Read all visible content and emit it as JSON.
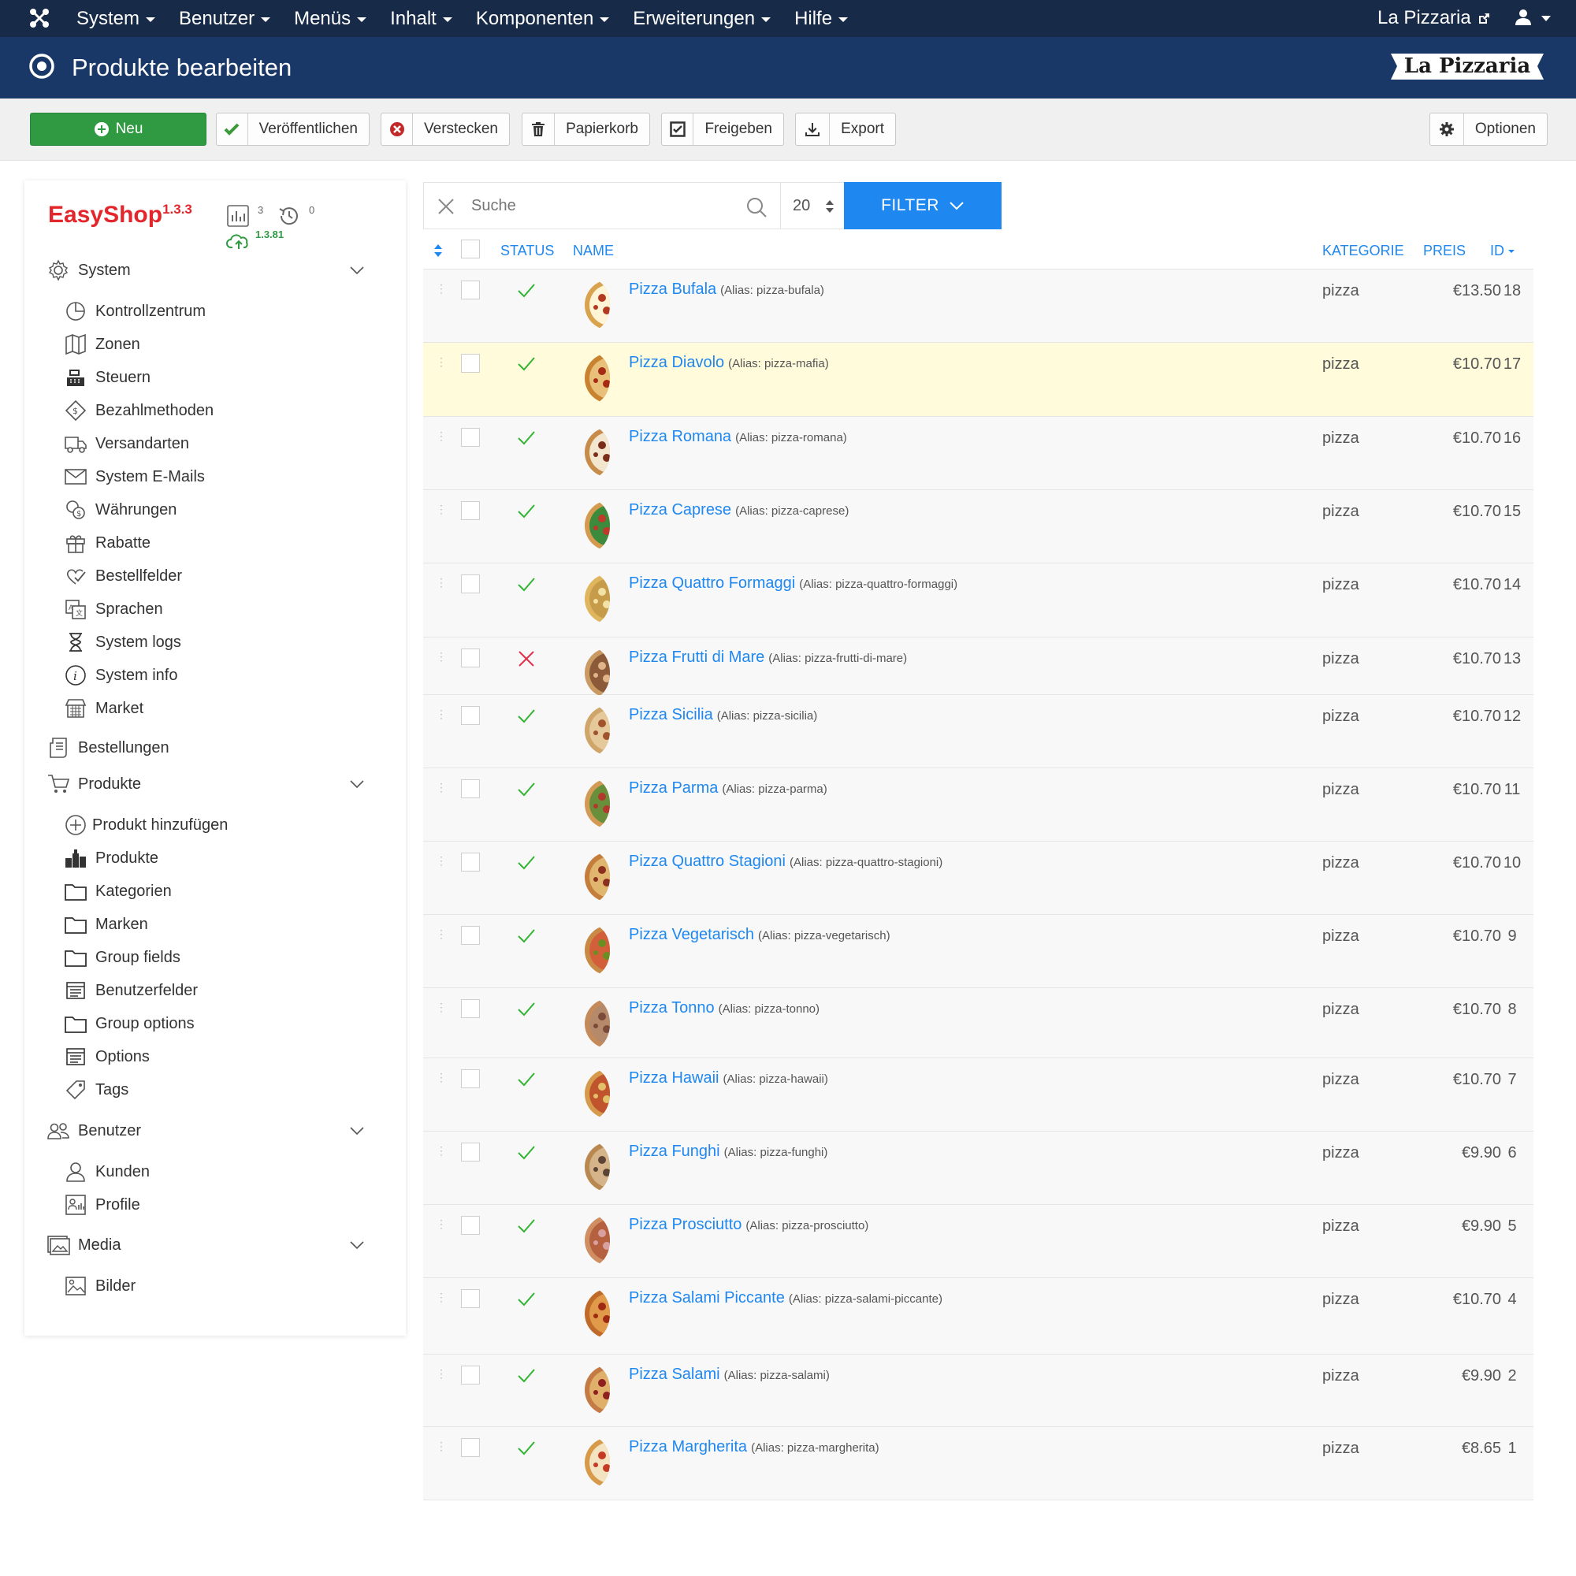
{
  "topbar": {
    "menu": [
      "System",
      "Benutzer",
      "Menüs",
      "Inhalt",
      "Komponenten",
      "Erweiterungen",
      "Hilfe"
    ],
    "site_link": "La Pizzaria"
  },
  "titlebar": {
    "title": "Produkte bearbeiten",
    "brand": "La Pizzaria"
  },
  "toolbar": {
    "new_label": "Neu",
    "publish_label": "Veröffentlichen",
    "hide_label": "Verstecken",
    "trash_label": "Papierkorb",
    "release_label": "Freigeben",
    "export_label": "Export",
    "options_label": "Optionen"
  },
  "sidebar": {
    "logo": "EasyShop",
    "logo_version": "1.3.3",
    "stat_count": "3",
    "stat_history": "0",
    "update_version": "1.3.81",
    "system": {
      "label": "System",
      "items": [
        "Kontrollzentrum",
        "Zonen",
        "Steuern",
        "Bezahlmethoden",
        "Versandarten",
        "System E-Mails",
        "Währungen",
        "Rabatte",
        "Bestellfelder",
        "Sprachen",
        "System logs",
        "System info",
        "Market"
      ]
    },
    "orders": {
      "label": "Bestellungen"
    },
    "products": {
      "label": "Produkte",
      "items": [
        "Produkt hinzufügen",
        "Produkte",
        "Kategorien",
        "Marken",
        "Group fields",
        "Benutzerfelder",
        "Group options",
        "Options",
        "Tags"
      ]
    },
    "users": {
      "label": "Benutzer",
      "items": [
        "Kunden",
        "Profile"
      ]
    },
    "media": {
      "label": "Media",
      "items": [
        "Bilder"
      ]
    }
  },
  "search": {
    "placeholder": "Suche",
    "limit": "20",
    "filter_label": "FILTER"
  },
  "table": {
    "headers": {
      "status": "STATUS",
      "name": "NAME",
      "category": "KATEGORIE",
      "price": "PREIS",
      "id": "ID"
    },
    "alias_prefix": "Alias:",
    "rows": [
      {
        "name": "Pizza Bufala",
        "alias": "pizza-bufala",
        "category": "pizza",
        "price": "€13.50",
        "id": "18",
        "published": true
      },
      {
        "name": "Pizza Diavolo",
        "alias": "pizza-mafia",
        "category": "pizza",
        "price": "€10.70",
        "id": "17",
        "published": true
      },
      {
        "name": "Pizza Romana",
        "alias": "pizza-romana",
        "category": "pizza",
        "price": "€10.70",
        "id": "16",
        "published": true
      },
      {
        "name": "Pizza Caprese",
        "alias": "pizza-caprese",
        "category": "pizza",
        "price": "€10.70",
        "id": "15",
        "published": true
      },
      {
        "name": "Pizza Quattro Formaggi",
        "alias": "pizza-quattro-formaggi",
        "category": "pizza",
        "price": "€10.70",
        "id": "14",
        "published": true
      },
      {
        "name": "Pizza Frutti di Mare",
        "alias": "pizza-frutti-di-mare",
        "category": "pizza",
        "price": "€10.70",
        "id": "13",
        "published": false
      },
      {
        "name": "Pizza Sicilia",
        "alias": "pizza-sicilia",
        "category": "pizza",
        "price": "€10.70",
        "id": "12",
        "published": true
      },
      {
        "name": "Pizza Parma",
        "alias": "pizza-parma",
        "category": "pizza",
        "price": "€10.70",
        "id": "11",
        "published": true
      },
      {
        "name": "Pizza Quattro Stagioni",
        "alias": "pizza-quattro-stagioni",
        "category": "pizza",
        "price": "€10.70",
        "id": "10",
        "published": true
      },
      {
        "name": "Pizza Vegetarisch",
        "alias": "pizza-vegetarisch",
        "category": "pizza",
        "price": "€10.70",
        "id": "9",
        "published": true
      },
      {
        "name": "Pizza Tonno",
        "alias": "pizza-tonno",
        "category": "pizza",
        "price": "€10.70",
        "id": "8",
        "published": true
      },
      {
        "name": "Pizza Hawaii",
        "alias": "pizza-hawaii",
        "category": "pizza",
        "price": "€10.70",
        "id": "7",
        "published": true
      },
      {
        "name": "Pizza Funghi",
        "alias": "pizza-funghi",
        "category": "pizza",
        "price": "€9.90",
        "id": "6",
        "published": true
      },
      {
        "name": "Pizza Prosciutto",
        "alias": "pizza-prosciutto",
        "category": "pizza",
        "price": "€9.90",
        "id": "5",
        "published": true
      },
      {
        "name": "Pizza Salami Piccante",
        "alias": "pizza-salami-piccante",
        "category": "pizza",
        "price": "€10.70",
        "id": "4",
        "published": true
      },
      {
        "name": "Pizza Salami",
        "alias": "pizza-salami",
        "category": "pizza",
        "price": "€9.90",
        "id": "2",
        "published": true
      },
      {
        "name": "Pizza Margherita",
        "alias": "pizza-margherita",
        "category": "pizza",
        "price": "€8.65",
        "id": "1",
        "published": true
      }
    ]
  }
}
